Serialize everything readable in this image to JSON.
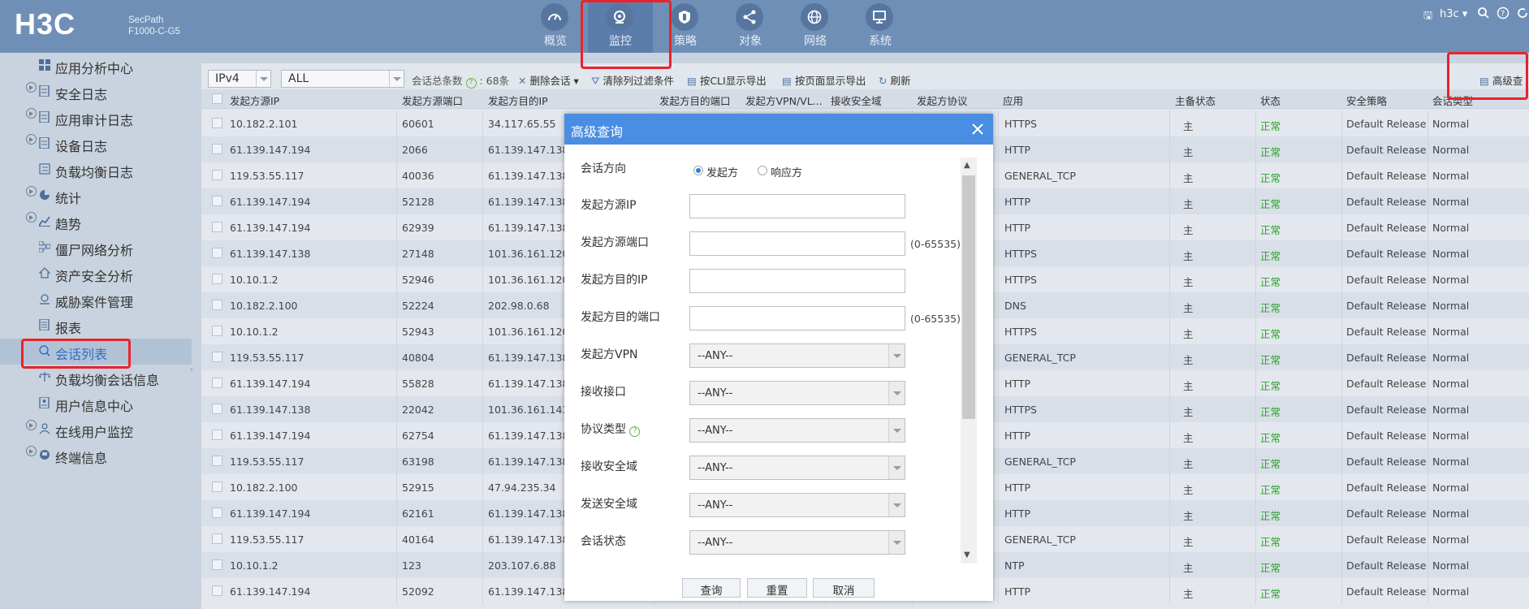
{
  "header": {
    "brand": "H3C",
    "product_line1": "SecPath",
    "product_line2": "F1000-C-G5",
    "nav": [
      {
        "label": "概览",
        "icon": "gauge-icon"
      },
      {
        "label": "监控",
        "icon": "monitor-camera-icon"
      },
      {
        "label": "策略",
        "icon": "shield-icon"
      },
      {
        "label": "对象",
        "icon": "share-nodes-icon"
      },
      {
        "label": "网络",
        "icon": "globe-icon"
      },
      {
        "label": "系统",
        "icon": "display-icon"
      }
    ],
    "active_nav": "监控",
    "user": "h3c"
  },
  "sidebar": {
    "items": [
      {
        "label": "应用分析中心",
        "icon": "grid-icon",
        "expandable": false
      },
      {
        "label": "安全日志",
        "icon": "document-icon",
        "expandable": true
      },
      {
        "label": "应用审计日志",
        "icon": "document-icon",
        "expandable": true
      },
      {
        "label": "设备日志",
        "icon": "document-icon",
        "expandable": true
      },
      {
        "label": "负载均衡日志",
        "icon": "list-icon",
        "expandable": false
      },
      {
        "label": "统计",
        "icon": "pie-chart-icon",
        "expandable": true
      },
      {
        "label": "趋势",
        "icon": "line-chart-icon",
        "expandable": true
      },
      {
        "label": "僵尸网络分析",
        "icon": "network-icon",
        "expandable": false
      },
      {
        "label": "资产安全分析",
        "icon": "house-icon",
        "expandable": false
      },
      {
        "label": "威胁案件管理",
        "icon": "case-icon",
        "expandable": false
      },
      {
        "label": "报表",
        "icon": "report-icon",
        "expandable": false
      },
      {
        "label": "会话列表",
        "icon": "session-icon",
        "expandable": false
      },
      {
        "label": "负载均衡会话信息",
        "icon": "balance-icon",
        "expandable": false
      },
      {
        "label": "用户信息中心",
        "icon": "user-doc-icon",
        "expandable": false
      },
      {
        "label": "在线用户监控",
        "icon": "user-monitor-icon",
        "expandable": true
      },
      {
        "label": "终端信息",
        "icon": "terminal-icon",
        "expandable": true
      }
    ],
    "active": "会话列表"
  },
  "toolbar": {
    "ip_version": "IPv4",
    "filter": "ALL",
    "session_total_label": "会话总条数",
    "session_total_value": "68条",
    "delete_label": "删除会话",
    "clear_filter_label": "清除列过滤条件",
    "export_cli_label": "按CLI显示导出",
    "export_page_label": "按页面显示导出",
    "refresh_label": "刷新",
    "advanced_label": "高级查"
  },
  "table": {
    "columns": [
      "发起方源IP",
      "发起方源端口",
      "发起方目的IP",
      "发起方目的端口",
      "发起方VPN/VL...",
      "接收安全域",
      "发起方协议",
      "应用",
      "主备状态",
      "状态",
      "安全策略",
      "会话类型"
    ],
    "rows": [
      [
        "10.182.2.101",
        "60601",
        "34.117.65.55",
        "HTTPS",
        "主",
        "正常",
        "Default Release",
        "Normal"
      ],
      [
        "61.139.147.194",
        "2066",
        "61.139.147.138",
        "HTTP",
        "主",
        "正常",
        "Default Release",
        "Normal"
      ],
      [
        "119.53.55.117",
        "40036",
        "61.139.147.138",
        "GENERAL_TCP",
        "主",
        "正常",
        "Default Release",
        "Normal"
      ],
      [
        "61.139.147.194",
        "52128",
        "61.139.147.138",
        "HTTP",
        "主",
        "正常",
        "Default Release",
        "Normal"
      ],
      [
        "61.139.147.194",
        "62939",
        "61.139.147.138",
        "HTTP",
        "主",
        "正常",
        "Default Release",
        "Normal"
      ],
      [
        "61.139.147.138",
        "27148",
        "101.36.161.120",
        "HTTPS",
        "主",
        "正常",
        "Default Release",
        "Normal"
      ],
      [
        "10.10.1.2",
        "52946",
        "101.36.161.120",
        "HTTPS",
        "主",
        "正常",
        "Default Release",
        "Normal"
      ],
      [
        "10.182.2.100",
        "52224",
        "202.98.0.68",
        "DNS",
        "主",
        "正常",
        "Default Release",
        "Normal"
      ],
      [
        "10.10.1.2",
        "52943",
        "101.36.161.120",
        "HTTPS",
        "主",
        "正常",
        "Default Release",
        "Normal"
      ],
      [
        "119.53.55.117",
        "40804",
        "61.139.147.138",
        "GENERAL_TCP",
        "主",
        "正常",
        "Default Release",
        "Normal"
      ],
      [
        "61.139.147.194",
        "55828",
        "61.139.147.138",
        "HTTP",
        "主",
        "正常",
        "Default Release",
        "Normal"
      ],
      [
        "61.139.147.138",
        "22042",
        "101.36.161.143",
        "HTTPS",
        "主",
        "正常",
        "Default Release",
        "Normal"
      ],
      [
        "61.139.147.194",
        "62754",
        "61.139.147.138",
        "HTTP",
        "主",
        "正常",
        "Default Release",
        "Normal"
      ],
      [
        "119.53.55.117",
        "63198",
        "61.139.147.138",
        "GENERAL_TCP",
        "主",
        "正常",
        "Default Release",
        "Normal"
      ],
      [
        "10.182.2.100",
        "52915",
        "47.94.235.34",
        "HTTP",
        "主",
        "正常",
        "Default Release",
        "Normal"
      ],
      [
        "61.139.147.194",
        "62161",
        "61.139.147.138",
        "HTTP",
        "主",
        "正常",
        "Default Release",
        "Normal"
      ],
      [
        "119.53.55.117",
        "40164",
        "61.139.147.138",
        "GENERAL_TCP",
        "主",
        "正常",
        "Default Release",
        "Normal"
      ],
      [
        "10.10.1.2",
        "123",
        "203.107.6.88",
        "NTP",
        "主",
        "正常",
        "Default Release",
        "Normal"
      ],
      [
        "61.139.147.194",
        "52092",
        "61.139.147.138",
        "HTTP",
        "主",
        "正常",
        "Default Release",
        "Normal"
      ]
    ]
  },
  "dialog": {
    "title": "高级查询",
    "direction_label": "会话方向",
    "direction_options": [
      "发起方",
      "响应方"
    ],
    "direction_selected": "发起方",
    "src_ip_label": "发起方源IP",
    "src_port_label": "发起方源端口",
    "dst_ip_label": "发起方目的IP",
    "dst_port_label": "发起方目的端口",
    "port_hint": "(0-65535)",
    "vpn_label": "发起方VPN",
    "recv_if_label": "接收接口",
    "proto_label": "协议类型",
    "recv_zone_label": "接收安全域",
    "send_zone_label": "发送安全域",
    "state_label": "会话状态",
    "any_value": "--ANY--",
    "query_button": "查询",
    "reset_button": "重置",
    "cancel_button": "取消"
  },
  "colors": {
    "header_bg": "#6f8fb6",
    "dialog_title_bg": "#4a8ee3",
    "status_ok": "#2aa12a",
    "highlight_red": "#e8232a"
  }
}
